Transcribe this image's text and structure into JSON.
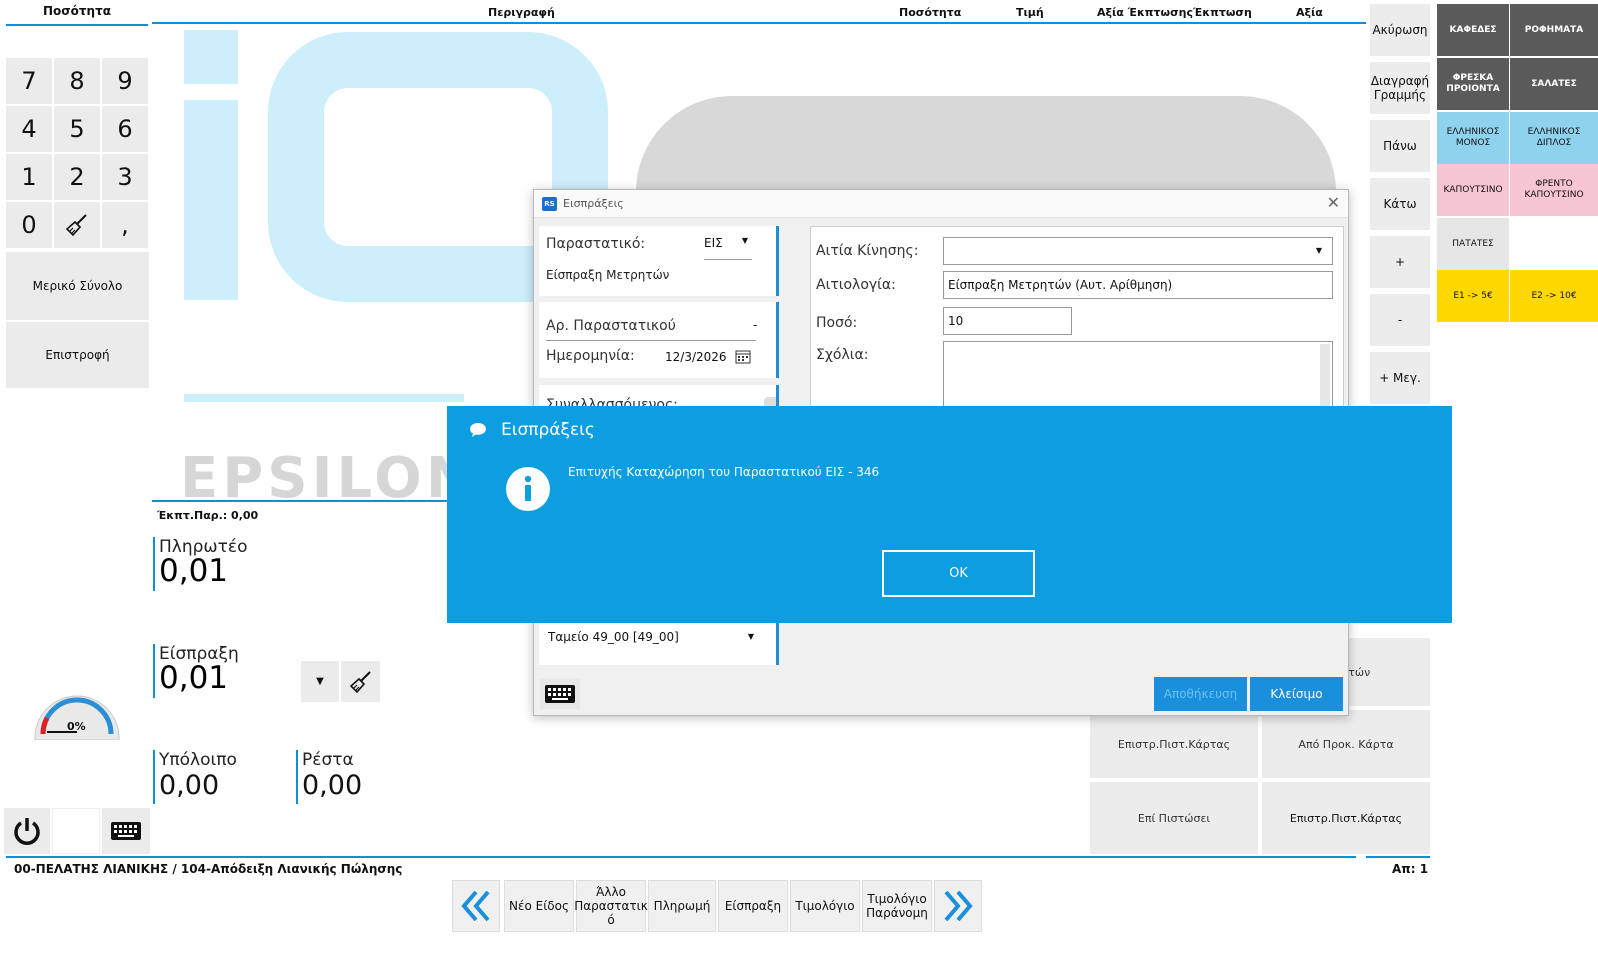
{
  "keypad": {
    "title": "Ποσότητα",
    "keys": [
      "7",
      "8",
      "9",
      "4",
      "5",
      "6",
      "1",
      "2",
      "3",
      "0",
      "",
      ","
    ],
    "partial_total": "Μερικό Σύνολο",
    "return": "Επιστροφή"
  },
  "table": {
    "cols": [
      "Περιγραφή",
      "Ποσότητα",
      "Τιμή",
      "Αξία Έκπτωσης",
      "Έκπτωση",
      "Αξία"
    ]
  },
  "background": {
    "brand": "EPSILON"
  },
  "side": {
    "cancel": "Ακύρωση",
    "delete_line": "Διαγραφή Γραμμής",
    "up": "Πάνω",
    "down": "Κάτω",
    "plus": "+",
    "minus": "-",
    "plus_big": "+ Μεγ."
  },
  "categories": [
    {
      "label": "ΚΑΦΕΔΕΣ",
      "color": "#5a5a5a",
      "text": "#ffffff"
    },
    {
      "label": "ΡΟΦΗΜΑΤΑ",
      "color": "#5a5a5a",
      "text": "#ffffff"
    },
    {
      "label": "ΦΡΕΣΚΑ ΠΡΟΙΟΝΤΑ",
      "color": "#5a5a5a",
      "text": "#ffffff"
    },
    {
      "label": "ΣΑΛΑΤΕΣ",
      "color": "#5a5a5a",
      "text": "#ffffff"
    },
    {
      "label": "ΕΛΛΗΝΙΚΟΣ ΜΟΝΟΣ",
      "color": "#8fd2ee",
      "text": "#111111"
    },
    {
      "label": "ΕΛΛΗΝΙΚΟΣ ΔΙΠΛΟΣ",
      "color": "#8fd2ee",
      "text": "#111111"
    },
    {
      "label": "ΚΑΠΟΥΤΣΙΝΟ",
      "color": "#f7c6d0",
      "text": "#111111"
    },
    {
      "label": "ΦΡΕΝΤΟ ΚΑΠΟΥΤΣΙΝΟ",
      "color": "#f7c6d0",
      "text": "#111111"
    },
    {
      "label": "ΠΑΤΑΤΕΣ",
      "color": "#e6e6e6",
      "text": "#111111"
    },
    {
      "label": "",
      "color": "#ffffff",
      "text": "#111111"
    },
    {
      "label": "Ε1 -> 5€",
      "color": "#ffd800",
      "text": "#111111"
    },
    {
      "label": "Ε2 -> 10€",
      "color": "#ffd800",
      "text": "#111111"
    }
  ],
  "totals": {
    "discount": "Έκπτ.Παρ.: 0,00",
    "payable_label": "Πληρωτέο",
    "payable": "0,01",
    "receipt_label": "Είσπραξη",
    "receipt": "0,01",
    "balance_label": "Υπόλοιπο",
    "balance": "0,00",
    "change_label": "Ρέστα",
    "change": "0,00",
    "gauge": "0%"
  },
  "pay_cells": {
    "card_right": "ετρητών",
    "ret_card_1": "Επιστρ.Πιστ.Κάρτας",
    "prepaid": "Από Προκ. Κάρτα",
    "credit": "Επί Πιστώσει",
    "ret_card_2": "Επιστρ.Πιστ.Κάρτας"
  },
  "status": {
    "customer": "00-ΠΕΛΑΤΗΣ ΛΙΑΝΙΚΗΣ / 104-Απόδειξη Λιανικής Πώλησης",
    "count": "Απ: 1"
  },
  "nav": {
    "new_item": "Νέο Είδος",
    "other_doc": "Άλλο Παραστατικ ό",
    "payment": "Πληρωμή",
    "receipt": "Είσπραξη",
    "invoice": "Τιμολόγιο",
    "invoice_delivery": "Τιμολόγιο Παράνομη"
  },
  "dialog": {
    "badge": "RS",
    "title": "Εισπράξεις",
    "doc_label": "Παραστατικό:",
    "doc_value": "ΕΙΣ",
    "doc_name": "Είσπραξη Μετρητών",
    "docno_label": "Αρ. Παραστατικού",
    "docno_value": "-",
    "date_label": "Ημερομηνία:",
    "date_value": "12/3/2026",
    "counterparty_label": "Συναλλασσόμενος:",
    "cashbox": "Ταμείο 49_00 [49_00]",
    "reason_label": "Αιτία Κίνησης:",
    "reason_value": "",
    "justification_label": "Αιτιολογία:",
    "justification_value": "Είσπραξη Μετρητών (Αυτ. Αρίθμηση)",
    "amount_label": "Ποσό:",
    "amount_value": "10",
    "comments_label": "Σχόλια:",
    "save": "Αποθήκευση",
    "close": "Κλείσιμο"
  },
  "message": {
    "title": "Εισπράξεις",
    "text": "Επιτυχής Καταχώρηση του Παραστατικού ΕΙΣ - 346",
    "ok": "OK",
    "accent": "#0c9ee0"
  }
}
